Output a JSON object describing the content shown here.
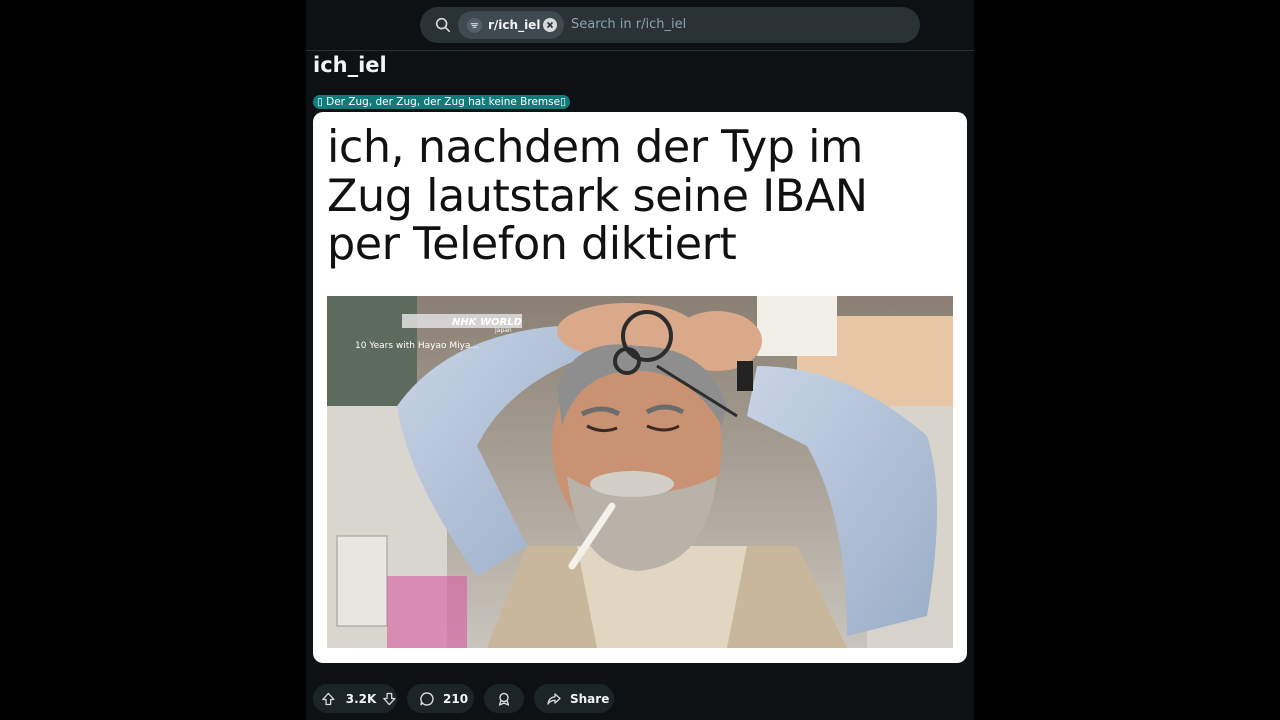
{
  "search": {
    "chip_label": "r/ich_iel",
    "placeholder": "Search in r/ich_iel"
  },
  "subreddit": {
    "name": "ich_iel"
  },
  "post": {
    "flair": "▯ Der Zug, der Zug, der Zug hat keine Bremse▯",
    "caption_lines": [
      "ich, nachdem der Typ im",
      "Zug lautstark seine IBAN",
      "per Telefon diktiert"
    ],
    "photo_overlay": {
      "logo": "NHK WORLD",
      "sublogo": "Japan",
      "subtitle": "10 Years with Hayao Miya..."
    }
  },
  "actions": {
    "vote_count": "3.2K",
    "comment_count": "210",
    "share_label": "Share"
  },
  "colors": {
    "background": "#0e1113",
    "flair": "#0f7c7b",
    "pill": "#1d2428",
    "search": "#2a3236"
  }
}
